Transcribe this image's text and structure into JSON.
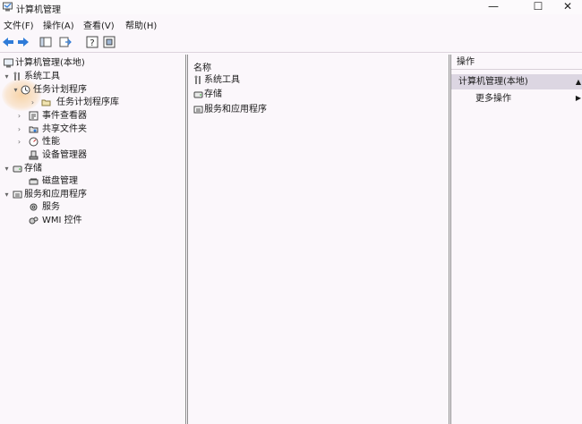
{
  "window": {
    "title": "计算机管理",
    "controls": {
      "minimize": "—",
      "maximize": "☐",
      "close": "✕"
    }
  },
  "menu": [
    "文件(F)",
    "操作(A)",
    "查看(V)",
    "帮助(H)"
  ],
  "toolbar": {
    "icons": [
      "back-icon",
      "forward-icon",
      "show-tree-icon",
      "export-list-icon",
      "help-icon",
      "properties-icon"
    ]
  },
  "tree": {
    "root": "计算机管理(本地)",
    "system_tools": "系统工具",
    "task_scheduler": "任务计划程序",
    "task_scheduler_library": "任务计划程序库",
    "event_viewer": "事件查看器",
    "shared_folders": "共享文件夹",
    "performance": "性能",
    "device_manager": "设备管理器",
    "storage": "存储",
    "disk_management": "磁盘管理",
    "services_apps": "服务和应用程序",
    "services": "服务",
    "wmi_control": "WMI 控件"
  },
  "center": {
    "column_header": "名称",
    "items": [
      "系统工具",
      "存储",
      "服务和应用程序"
    ]
  },
  "actions": {
    "header": "操作",
    "section": "计算机管理(本地)",
    "item": "更多操作"
  },
  "colors": {
    "background": "#fbf7fb",
    "selection": "#dcd6e2",
    "accent_blue": "#2f7bd8",
    "cursor_highlight": "#f6c88c"
  }
}
